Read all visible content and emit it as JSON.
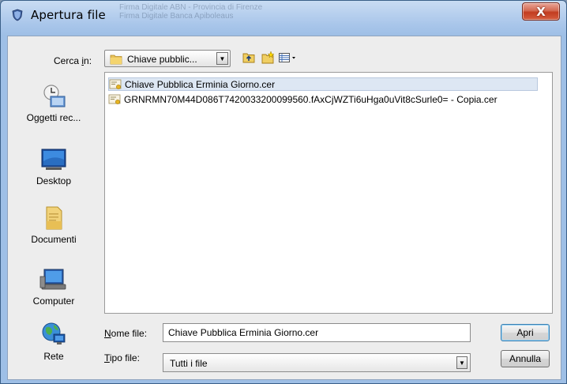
{
  "window": {
    "title": "Apertura file",
    "close_glyph": "X",
    "ghost_titles": [
      "Firma Digitale ABN - Provincia di Firenze",
      "Firma Digitale Banca Apiboleaus"
    ]
  },
  "lookin": {
    "label_prefix": "Cerca ",
    "label_underlined": "i",
    "label_suffix": "n:",
    "value": "Chiave pubblic...",
    "icons": [
      "up-folder-icon",
      "new-folder-icon",
      "view-menu-icon"
    ]
  },
  "places": [
    {
      "label": "Oggetti rec...",
      "icon": "recent-items-icon"
    },
    {
      "label": "Desktop",
      "icon": "desktop-icon"
    },
    {
      "label": "Documenti",
      "icon": "documents-icon"
    },
    {
      "label": "Computer",
      "icon": "computer-icon"
    },
    {
      "label": "Rete",
      "icon": "network-icon"
    }
  ],
  "files": [
    {
      "name": "Chiave Pubblica Erminia Giorno.cer",
      "selected": true
    },
    {
      "name": "GRNRMN70M44D086T7420033200099560.fAxCjWZTi6uHga0uVit8cSurle0= - Copia.cer",
      "selected": false
    }
  ],
  "filename": {
    "label_underlined": "N",
    "label_rest": "ome file:",
    "value": "Chiave Pubblica Erminia Giorno.cer"
  },
  "filetype": {
    "label_underlined": "T",
    "label_rest": "ipo file:",
    "value": "Tutti i file"
  },
  "buttons": {
    "open": "Apri",
    "cancel": "Annulla"
  },
  "colors": {
    "title_gradient": "#a9c6ea",
    "close_button": "#c23c20",
    "selection": "#dde7f3"
  }
}
